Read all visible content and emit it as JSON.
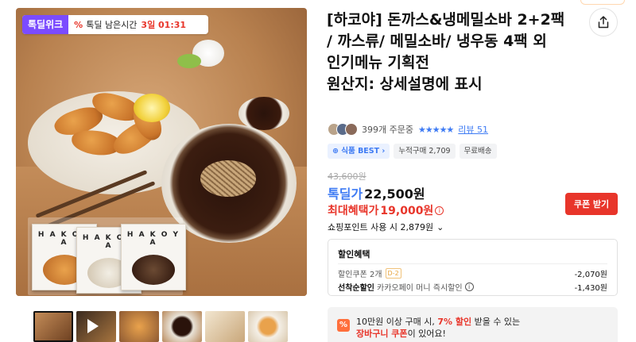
{
  "product": {
    "deal_badge": {
      "logo": "톡딜위크",
      "icon": "percent-icon",
      "label": "톡딜 남은시간",
      "time": "3일 01:31"
    },
    "package_brand": "H A K O Y A",
    "thumbnails": [
      "cutlet-and-soba",
      "video",
      "cutlet-closeup",
      "soba-bowl",
      "menu-set",
      "cutlet-plate"
    ],
    "title": "[하코야] 돈까스&냉메밀소바 2+2팩 / 까스류/ 메밀소바/ 냉우동 4팩 외 인기메뉴 기획전",
    "origin": "원산지: 상세설명에 표시",
    "orders": "399개 주문중",
    "stars": "★★★★★",
    "review_link": "리뷰 51",
    "tags": [
      "식품 BEST",
      "누적구매 2,709",
      "무료배송"
    ],
    "tag_best_icon": "plus-circle-icon",
    "original_price": "43,600원",
    "deal_price_label": "톡딜가",
    "deal_price": "22,500원",
    "max_benefit_label": "최대혜택가",
    "max_benefit_price": "19,000원",
    "coupon_button": "쿠폰 받기",
    "points": "쇼핑포인트 사용 시 2,879원",
    "discount": {
      "header": "할인혜택",
      "rows": [
        {
          "label": "할인쿠폰 2개",
          "badge": "D-2",
          "amount": "-2,070원"
        },
        {
          "label_strong": "선착순할인",
          "label": "카카오페이 머니 즉시할인",
          "amount": "-1,430원"
        }
      ]
    },
    "cart_banner": {
      "icon": "percent-tag-icon",
      "line1_a": "10만원 이상 구매 시,",
      "line1_b": "7% 할인",
      "line1_c": "받을 수 있는",
      "line2_a": "장바구니 쿠폰",
      "line2_b": "이 있어요!"
    },
    "colors": {
      "brand": "#7b4bff",
      "accent_red": "#e8352a",
      "link_blue": "#3e7bf4"
    }
  }
}
